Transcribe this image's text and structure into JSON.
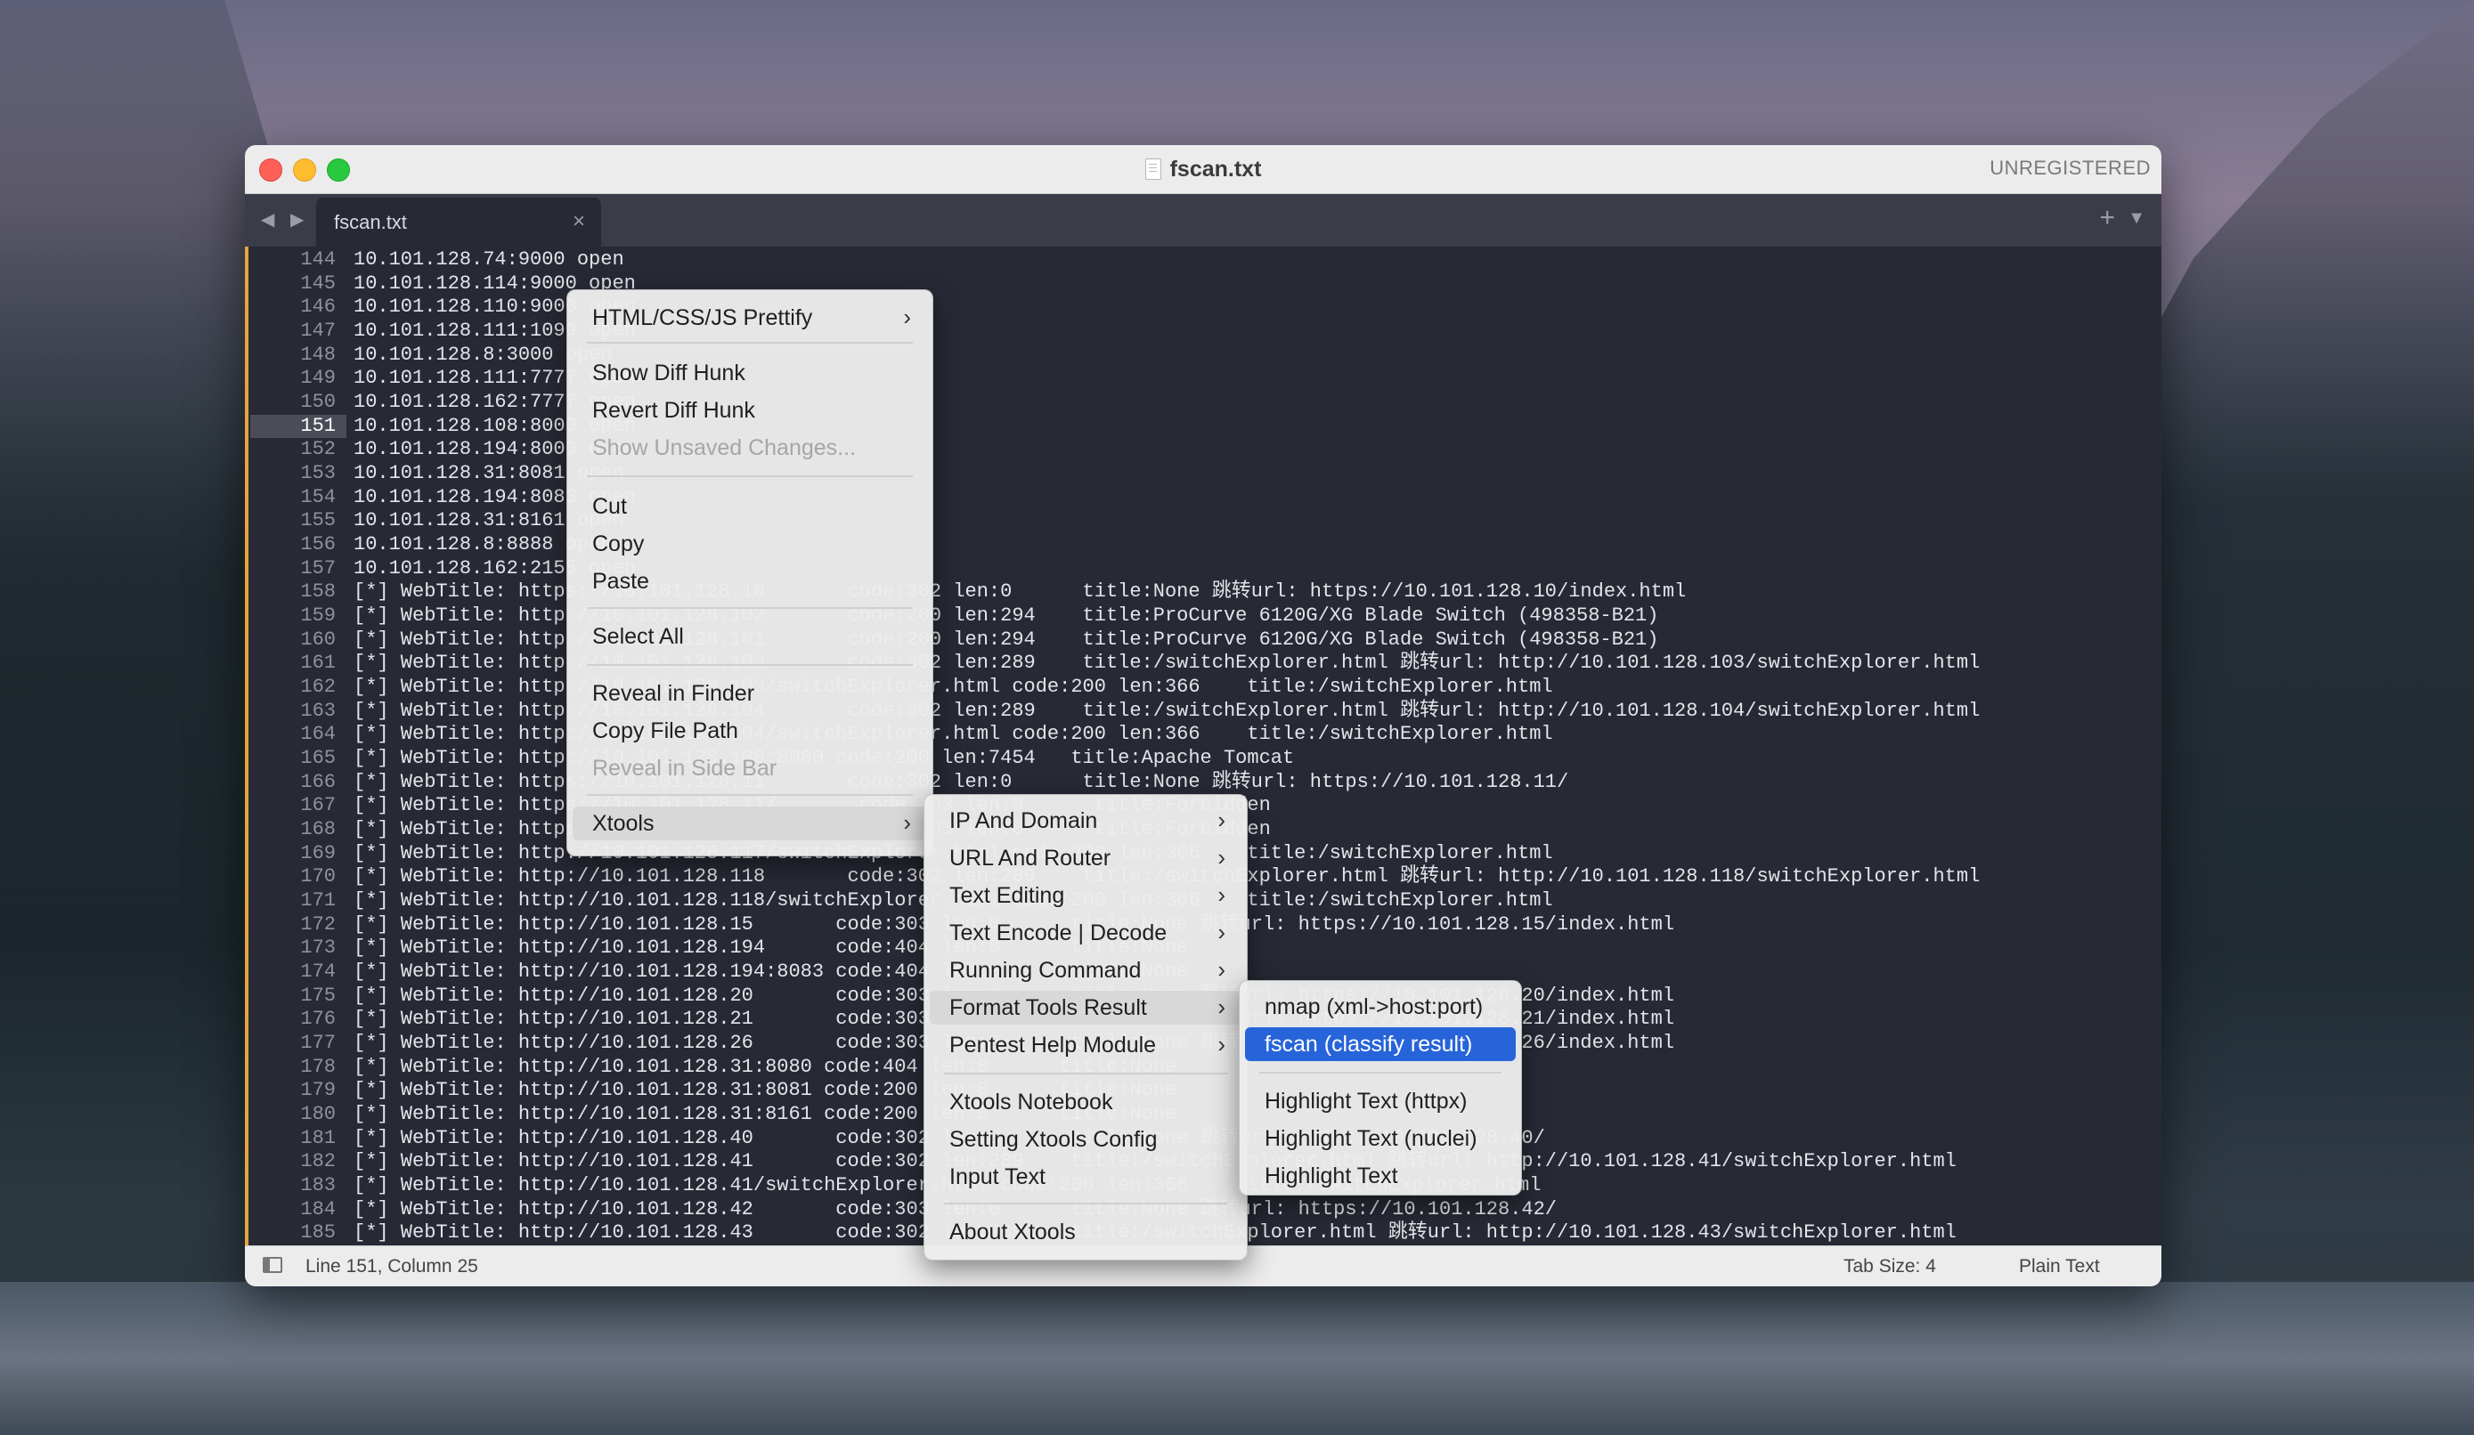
{
  "window": {
    "title": "fscan.txt",
    "registration": "UNREGISTERED"
  },
  "tabbar": {
    "nav": "◀ ▶",
    "tab_label": "fscan.txt",
    "close": "×",
    "new_tab": "+",
    "menu": "▼"
  },
  "editor": {
    "current_line": 151,
    "lines": [
      {
        "n": "144",
        "t": "10.101.128.74:9000 open"
      },
      {
        "n": "145",
        "t": "10.101.128.114:9000 open"
      },
      {
        "n": "146",
        "t": "10.101.128.110:9000 open"
      },
      {
        "n": "147",
        "t": "10.101.128.111:1099 open"
      },
      {
        "n": "148",
        "t": "10.101.128.8:3000 open"
      },
      {
        "n": "149",
        "t": "10.101.128.111:7777 open"
      },
      {
        "n": "150",
        "t": "10.101.128.162:7777 open"
      },
      {
        "n": "151",
        "t": "10.101.128.108:8000 open"
      },
      {
        "n": "152",
        "t": "10.101.128.194:8000 open"
      },
      {
        "n": "153",
        "t": "10.101.128.31:8081 open"
      },
      {
        "n": "154",
        "t": "10.101.128.194:8083 open"
      },
      {
        "n": "155",
        "t": "10.101.128.31:8161 open"
      },
      {
        "n": "156",
        "t": "10.101.128.8:8888 open"
      },
      {
        "n": "157",
        "t": "10.101.128.162:2155 open"
      },
      {
        "n": "158",
        "t": "[*] WebTitle: https://10.101.128.10       code:302 len:0      title:None 跳转url: https://10.101.128.10/index.html"
      },
      {
        "n": "159",
        "t": "[*] WebTitle: http://10.101.128.102       code:200 len:294    title:ProCurve 6120G/XG Blade Switch (498358-B21)"
      },
      {
        "n": "160",
        "t": "[*] WebTitle: http://10.101.128.101       code:200 len:294    title:ProCurve 6120G/XG Blade Switch (498358-B21)"
      },
      {
        "n": "161",
        "t": "[*] WebTitle: http://10.101.128.103       code:302 len:289    title:/switchExplorer.html 跳转url: http://10.101.128.103/switchExplorer.html"
      },
      {
        "n": "162",
        "t": "[*] WebTitle: http://10.101.128.103/switchExplorer.html code:200 len:366    title:/switchExplorer.html"
      },
      {
        "n": "163",
        "t": "[*] WebTitle: http://10.101.128.104       code:302 len:289    title:/switchExplorer.html 跳转url: http://10.101.128.104/switchExplorer.html"
      },
      {
        "n": "164",
        "t": "[*] WebTitle: http://10.101.128.104/switchExplorer.html code:200 len:366    title:/switchExplorer.html"
      },
      {
        "n": "165",
        "t": "[*] WebTitle: http://10.101.128.108:8000 code:200 len:7454   title:Apache Tomcat"
      },
      {
        "n": "166",
        "t": "[*] WebTitle: https://10.101.128.11       code:302 len:0      title:None 跳转url: https://10.101.128.11/"
      },
      {
        "n": "167",
        "t": "[*] WebTitle: https://10.101.128.11/       code:403 len:0      title:Forbidden"
      },
      {
        "n": "168",
        "t": "[*] WebTitle: https://10.101.128.12/       code:403 len:0      title:Forbidden"
      },
      {
        "n": "169",
        "t": "[*] WebTitle: http://10.101.128.117/switchExplorer.html code:200 len:366    title:/switchExplorer.html"
      },
      {
        "n": "170",
        "t": "[*] WebTitle: http://10.101.128.118       code:302 len:289    title:/switchExplorer.html 跳转url: http://10.101.128.118/switchExplorer.html"
      },
      {
        "n": "171",
        "t": "[*] WebTitle: http://10.101.128.118/switchExplorer.html code:200 len:366    title:/switchExplorer.html"
      },
      {
        "n": "172",
        "t": "[*] WebTitle: http://10.101.128.15       code:303 len:0      title:None 跳转url: https://10.101.128.15/index.html"
      },
      {
        "n": "173",
        "t": "[*] WebTitle: http://10.101.128.194      code:404 len:0      title:None"
      },
      {
        "n": "174",
        "t": "[*] WebTitle: http://10.101.128.194:8083 code:404 len:0      title:None"
      },
      {
        "n": "175",
        "t": "[*] WebTitle: http://10.101.128.20       code:303 len:0      title:None 跳转url: https://10.101.128.20/index.html"
      },
      {
        "n": "176",
        "t": "[*] WebTitle: http://10.101.128.21       code:303 len:0      title:None 跳转url: https://10.101.128.21/index.html"
      },
      {
        "n": "177",
        "t": "[*] WebTitle: http://10.101.128.26       code:303 len:0      title:None 跳转url: https://10.101.128.26/index.html"
      },
      {
        "n": "178",
        "t": "[*] WebTitle: http://10.101.128.31:8080 code:404 len:0      title:None"
      },
      {
        "n": "179",
        "t": "[*] WebTitle: http://10.101.128.31:8081 code:200 len:0      title:None"
      },
      {
        "n": "180",
        "t": "[*] WebTitle: http://10.101.128.31:8161 code:200 len:0      title:None"
      },
      {
        "n": "181",
        "t": "[*] WebTitle: http://10.101.128.40       code:302 len:0      title:None 跳转url: http://10.101.128.40/"
      },
      {
        "n": "182",
        "t": "[*] WebTitle: http://10.101.128.41       code:302 len:289    title:/switchExplorer.html 跳转url: http://10.101.128.41/switchExplorer.html"
      },
      {
        "n": "183",
        "t": "[*] WebTitle: http://10.101.128.41/switchExplorer.html code:200 len:366    title:/switchExplorer.html"
      },
      {
        "n": "184",
        "t": "[*] WebTitle: http://10.101.128.42       code:303 len:0      title:None 跳转url: https://10.101.128.42/"
      },
      {
        "n": "185",
        "t": "[*] WebTitle: http://10.101.128.43       code:302 len:289    title:/switchExplorer.html 跳转url: http://10.101.128.43/switchExplorer.html"
      }
    ]
  },
  "context_menu": {
    "items": [
      {
        "label": "HTML/CSS/JS Prettify",
        "submenu": true
      },
      {
        "label": "Show Diff Hunk"
      },
      {
        "label": "Revert Diff Hunk"
      },
      {
        "label": "Show Unsaved Changes...",
        "disabled": true
      },
      {
        "label": "Cut"
      },
      {
        "label": "Copy"
      },
      {
        "label": "Paste"
      },
      {
        "label": "Select All"
      },
      {
        "label": "Reveal in Finder"
      },
      {
        "label": "Copy File Path"
      },
      {
        "label": "Reveal in Side Bar",
        "disabled": true
      },
      {
        "label": "Xtools",
        "submenu": true
      }
    ]
  },
  "xtools_menu": {
    "items": [
      {
        "label": "IP And Domain",
        "submenu": true
      },
      {
        "label": "URL And Router",
        "submenu": true
      },
      {
        "label": "Text Editing",
        "submenu": true
      },
      {
        "label": "Text Encode | Decode",
        "submenu": true
      },
      {
        "label": "Running Command",
        "submenu": true
      },
      {
        "label": "Format Tools Result",
        "submenu": true
      },
      {
        "label": "Pentest Help Module",
        "submenu": true
      },
      {
        "label": "Xtools Notebook"
      },
      {
        "label": "Setting Xtools Config"
      },
      {
        "label": "Input Text"
      },
      {
        "label": "About Xtools"
      }
    ]
  },
  "format_menu": {
    "items": [
      {
        "label": "nmap (xml->host:port)"
      },
      {
        "label": "fscan (classify result)",
        "selected": true
      },
      {
        "label": "Highlight Text (httpx)"
      },
      {
        "label": "Highlight Text (nuclei)"
      },
      {
        "label": "Highlight Text"
      }
    ]
  },
  "statusbar": {
    "position": "Line 151, Column 25",
    "tab_size": "Tab Size: 4",
    "syntax": "Plain Text"
  },
  "colors": {
    "accent": "#2764d9",
    "gutter_mark": "#e5a53b",
    "editor_bg": "#272a35"
  }
}
